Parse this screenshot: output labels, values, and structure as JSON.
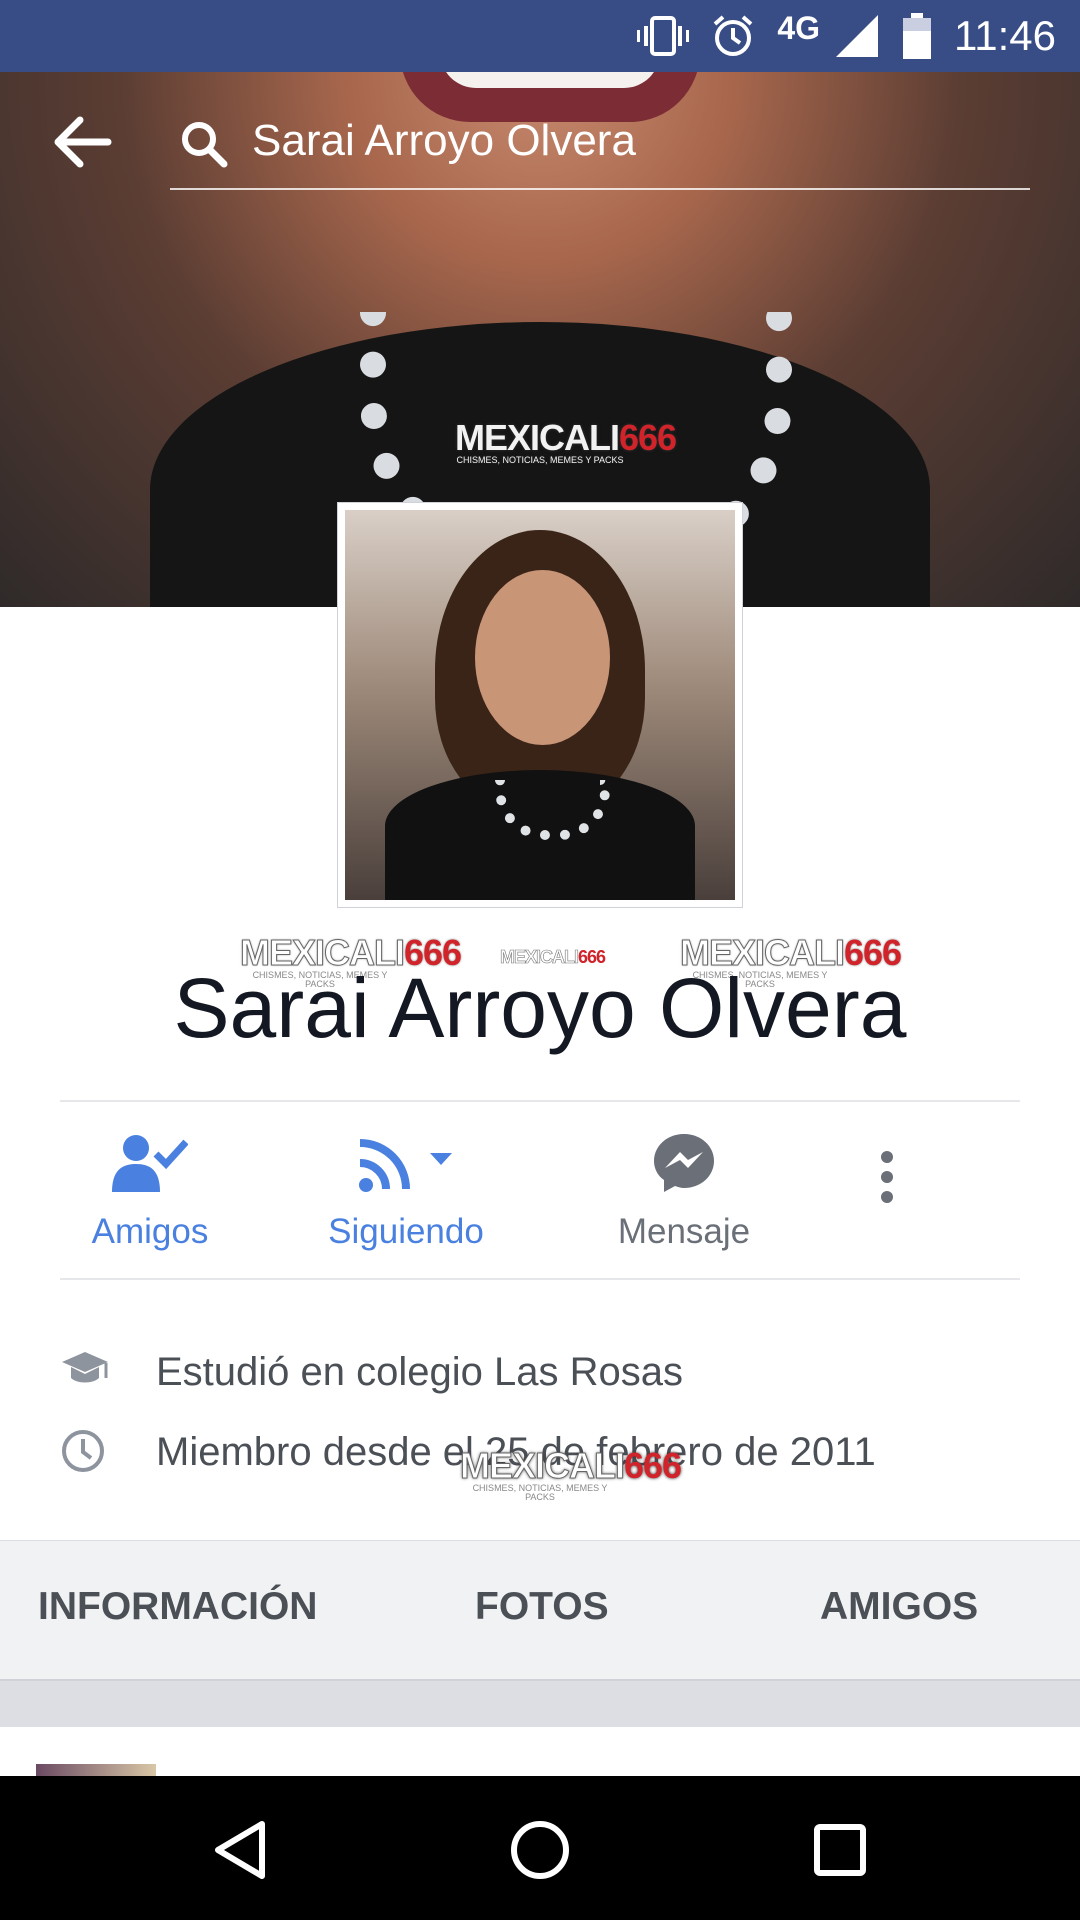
{
  "status_bar": {
    "network": "4G",
    "time": "11:46",
    "icons": [
      "vibrate-icon",
      "alarm-icon",
      "signal-icon",
      "battery-icon"
    ]
  },
  "search": {
    "query": "Sarai Arroyo Olvera"
  },
  "watermark": {
    "brand": "MEXICALI",
    "number": "666",
    "tagline": "CHISMES, NOTICIAS, MEMES Y PACKS"
  },
  "profile": {
    "name": "Sarai Arroyo Olvera"
  },
  "actions": [
    {
      "label": "Amigos",
      "icon": "friends-check-icon",
      "color": "#4a80e0"
    },
    {
      "label": "Siguiendo",
      "icon": "following-rss-icon",
      "color": "#4a80e0"
    },
    {
      "label": "Mensaje",
      "icon": "messenger-icon",
      "color": "#6a6f78"
    },
    {
      "label": "",
      "icon": "more-vertical-icon",
      "color": "#6a6f78"
    }
  ],
  "info": [
    {
      "icon": "graduation-cap-icon",
      "text": "Estudió en colegio Las Rosas"
    },
    {
      "icon": "clock-icon",
      "text": "Miembro desde el 25 de febrero de 2011"
    }
  ],
  "tabs": [
    "INFORMACIÓN",
    "FOTOS",
    "AMIGOS"
  ],
  "colors": {
    "status_bar": "#384d86",
    "accent": "#4a80e0",
    "text_primary": "#141823",
    "text_secondary": "#4b4f56"
  }
}
